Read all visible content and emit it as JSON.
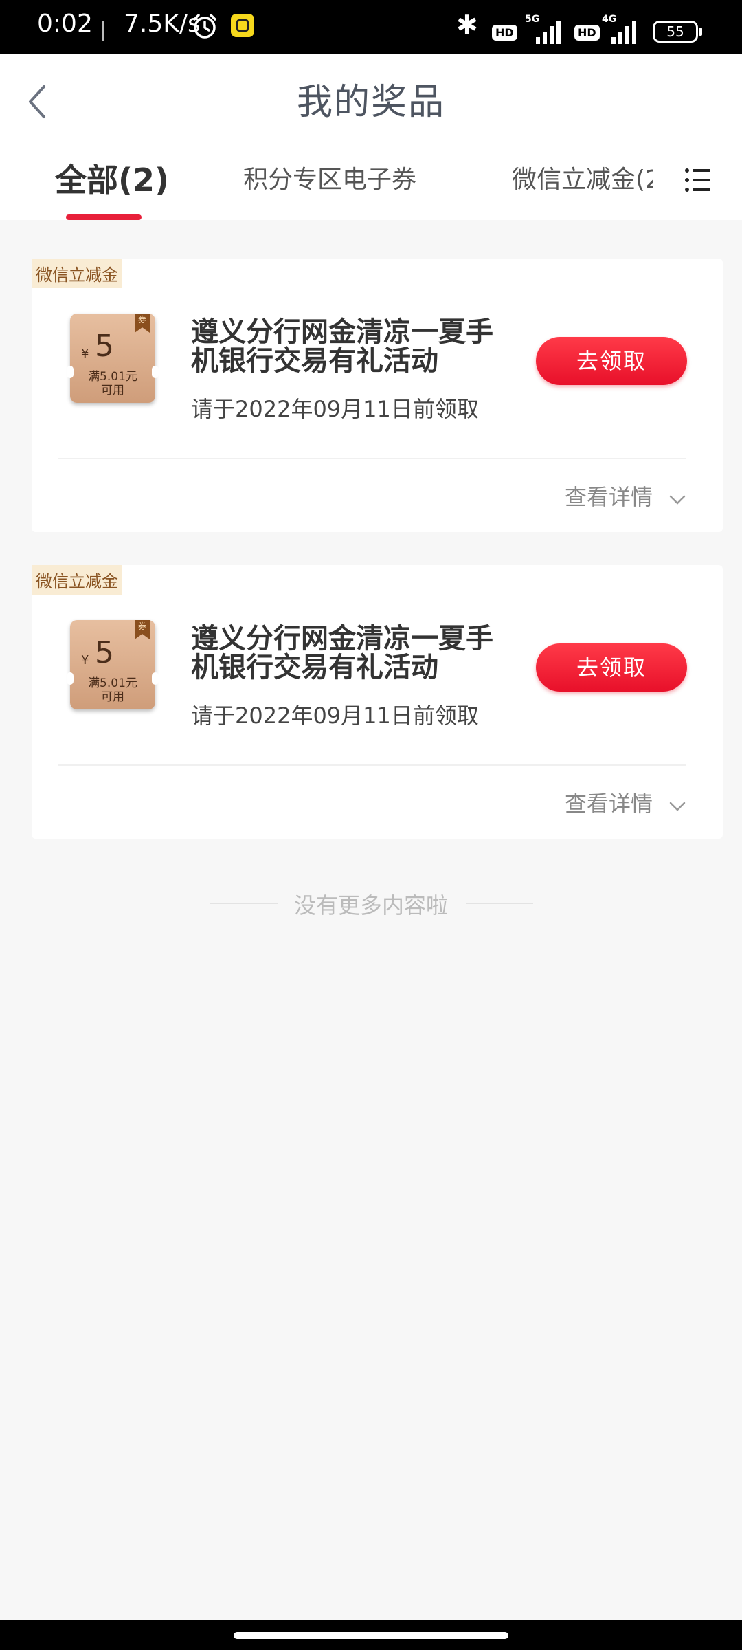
{
  "status_bar": {
    "time": "0:02",
    "speed": "7.5K/s",
    "network_1": "5G",
    "network_2": "4G",
    "hd_label": "HD",
    "battery": "55"
  },
  "header": {
    "title": "我的奖品"
  },
  "tabs": [
    {
      "label": "全部(2)"
    },
    {
      "label": "积分专区电子券"
    },
    {
      "label": "微信立减金(2"
    }
  ],
  "cards": [
    {
      "tag": "微信立减金",
      "coupon_badge": "券",
      "coupon_currency": "¥",
      "coupon_amount": "5",
      "coupon_condition_1": "满5.01元",
      "coupon_condition_2": "可用",
      "title": "遵义分行网金清凉一夏手机银行交易有礼活动",
      "deadline": "请于2022年09月11日前领取",
      "button_label": "去领取",
      "details_label": "查看详情"
    },
    {
      "tag": "微信立减金",
      "coupon_badge": "券",
      "coupon_currency": "¥",
      "coupon_amount": "5",
      "coupon_condition_1": "满5.01元",
      "coupon_condition_2": "可用",
      "title": "遵义分行网金清凉一夏手机银行交易有礼活动",
      "deadline": "请于2022年09月11日前领取",
      "button_label": "去领取",
      "details_label": "查看详情"
    }
  ],
  "footer": {
    "no_more": "没有更多内容啦"
  },
  "colors": {
    "accent": "#e8203a",
    "title": "#4e5561",
    "tag_bg": "#f9ecd4",
    "tag_text": "#8a5422"
  }
}
